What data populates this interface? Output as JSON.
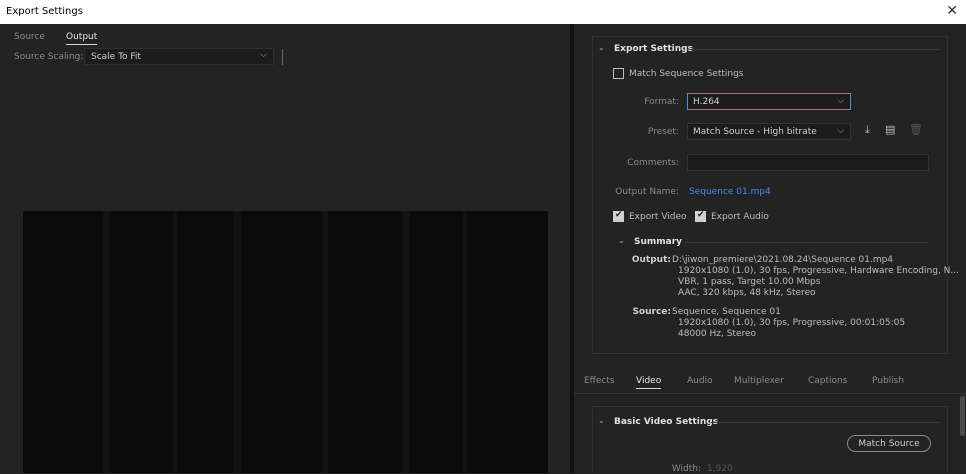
{
  "window": {
    "title": "Export Settings",
    "close_glyph": "✕"
  },
  "left_tabs": [
    {
      "label": "Source"
    },
    {
      "label": "Output"
    }
  ],
  "source_scaling": {
    "label": "Source Scaling:",
    "value": "Scale To Fit"
  },
  "export_settings": {
    "title": "Export Settings",
    "match_sequence": "Match Sequence Settings",
    "format_label": "Format:",
    "format_value": "H.264",
    "preset_label": "Preset:",
    "preset_value": "Match Source - High bitrate",
    "comments_label": "Comments:",
    "comments_value": "",
    "output_name_label": "Output Name:",
    "output_name_value": "Sequence 01.mp4",
    "export_video": "Export Video",
    "export_audio": "Export Audio"
  },
  "summary": {
    "title": "Summary",
    "output_key": "Output:",
    "output_lines": [
      "D:\\jiwon_premiere\\2021.08.24\\Sequence 01.mp4",
      "1920x1080 (1.0), 30 fps, Progressive, Hardware Encoding, N...",
      "VBR, 1 pass, Target 10.00 Mbps",
      "AAC, 320 kbps, 48 kHz, Stereo"
    ],
    "source_key": "Source:",
    "source_lines": [
      "Sequence, Sequence 01",
      "1920x1080 (1.0), 30 fps, Progressive, 00:01:05:05",
      "48000 Hz, Stereo"
    ]
  },
  "bottom_tabs": [
    {
      "label": "Effects"
    },
    {
      "label": "Video"
    },
    {
      "label": "Audio"
    },
    {
      "label": "Multiplexer"
    },
    {
      "label": "Captions"
    },
    {
      "label": "Publish"
    }
  ],
  "basic_video": {
    "title": "Basic Video Settings",
    "match_source": "Match Source",
    "width_label": "Width:",
    "width_value": "1,920"
  },
  "colors": {
    "accent": "#3f8cef",
    "background": "#232323"
  }
}
